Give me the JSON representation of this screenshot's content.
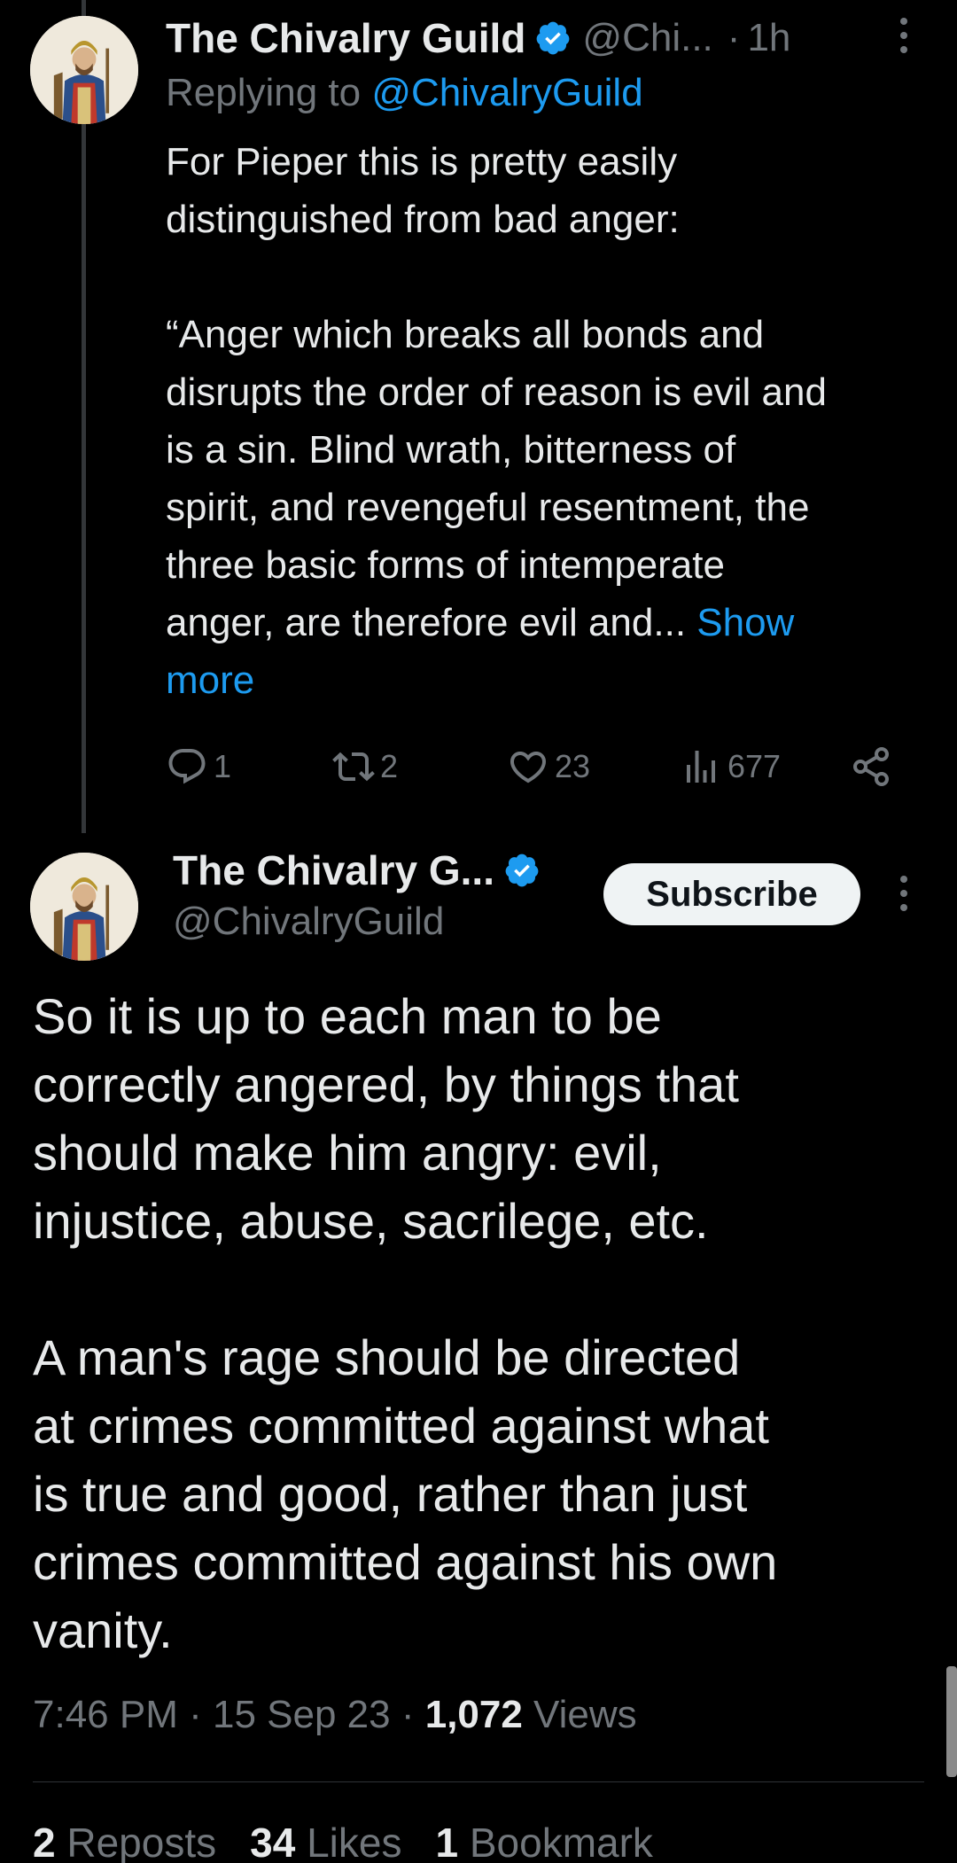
{
  "reply_tweet": {
    "display_name": "The Chivalry Guild",
    "handle_truncated": "@Chi...",
    "separator": "·",
    "time_ago": "1h",
    "replying_prefix": "Replying to ",
    "replying_mention": "@ChivalryGuild",
    "text": "For Pieper this is pretty easily\ndistinguished from bad anger:\n\n“Anger which breaks all bonds and\ndisrupts the order of reason is evil and\nis a sin. Blind wrath, bitterness of\nspirit, and revengeful resentment, the\nthree basic forms of intemperate\nanger, are therefore evil and... ",
    "show_more": "Show\nmore",
    "actions": {
      "replies": "1",
      "reposts": "2",
      "likes": "23",
      "views": "677"
    }
  },
  "main_tweet": {
    "display_name": "The Chivalry G...",
    "handle": "@ChivalryGuild",
    "subscribe_label": "Subscribe",
    "text": "So it is up to each man to be\ncorrectly angered, by things that\nshould make him angry: evil,\ninjustice, abuse, sacrilege, etc.\n\nA man's rage should be directed\nat crimes committed against what\nis true and good, rather than just\ncrimes committed against his own\nvanity.",
    "time": "7:46 PM",
    "date": "15 Sep 23",
    "separator": " · ",
    "views_count": "1,072",
    "views_label": " Views",
    "stats": {
      "reposts_count": "2",
      "reposts_label": " Reposts",
      "likes_count": "34",
      "likes_label": " Likes",
      "bookmarks_count": "1",
      "bookmarks_label": " Bookmark"
    }
  },
  "colors": {
    "background": "#000000",
    "text_primary": "#e7e9ea",
    "text_secondary": "#71767b",
    "accent_blue": "#1d9bf0",
    "verified_blue": "#1d9bf0"
  },
  "icons": [
    "verified-badge-icon",
    "more-icon",
    "reply-icon",
    "repost-icon",
    "like-icon",
    "views-icon",
    "share-icon"
  ]
}
